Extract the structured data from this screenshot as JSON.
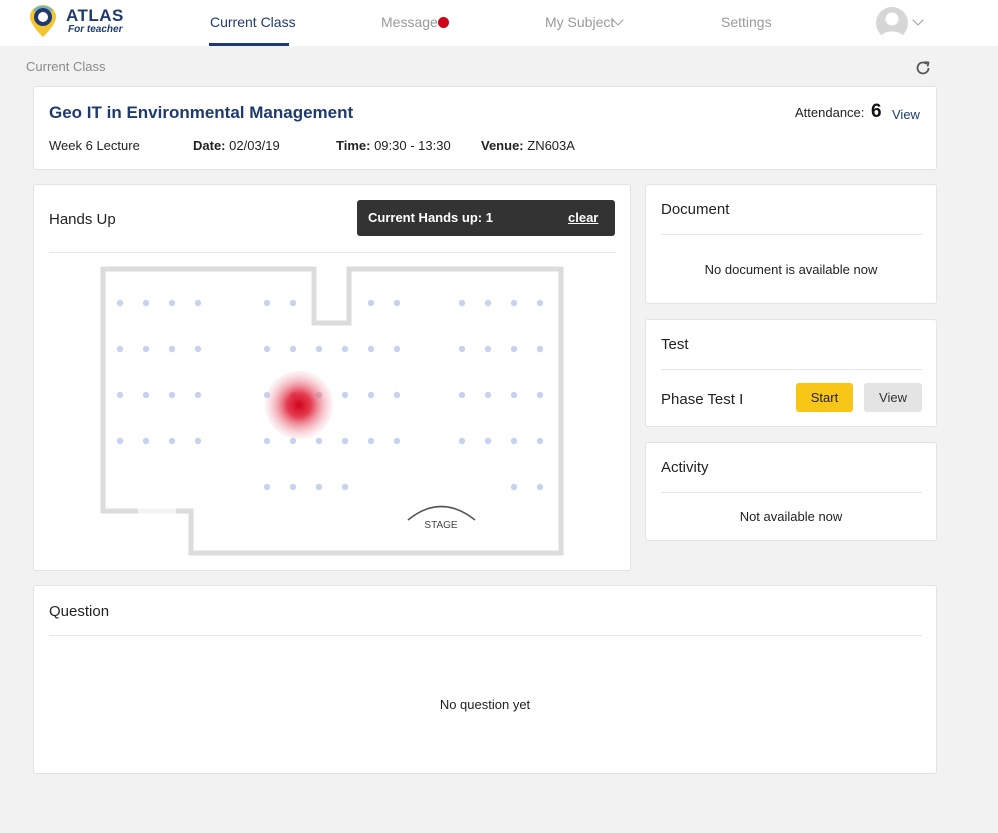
{
  "brand": {
    "name": "ATLAS",
    "subtitle": "For teacher"
  },
  "nav": {
    "current_class": "Current Class",
    "message": "Message",
    "my_subject": "My Subject",
    "settings": "Settings"
  },
  "breadcrumb": "Current Class",
  "class_info": {
    "title": "Geo IT in Environmental Management",
    "lecture": "Week 6 Lecture",
    "date_label": "Date:",
    "date": "02/03/19",
    "time_label": "Time:",
    "time": "09:30 - 13:30",
    "venue_label": "Venue:",
    "venue": "ZN603A",
    "attendance_label": "Attendance:",
    "attendance_count": "6",
    "attendance_view": "View"
  },
  "hands_up": {
    "title": "Hands Up",
    "badge_label": "Current Hands up: 1",
    "clear_label": "clear",
    "stage_label": "STAGE"
  },
  "document": {
    "title": "Document",
    "empty": "No document is available now"
  },
  "test": {
    "title": "Test",
    "name": "Phase Test I",
    "start_label": "Start",
    "view_label": "View"
  },
  "activity": {
    "title": "Activity",
    "empty": "Not available now"
  },
  "question": {
    "title": "Question",
    "empty": "No question yet"
  },
  "colors": {
    "brand": "#1e3a6e",
    "accent": "#f8c617",
    "alert": "#d0021b",
    "seat": "#c7d3ee"
  },
  "icons": [
    "location-pin-icon",
    "message-dot-icon",
    "chevron-down-icon",
    "user-avatar-icon",
    "refresh-icon"
  ]
}
